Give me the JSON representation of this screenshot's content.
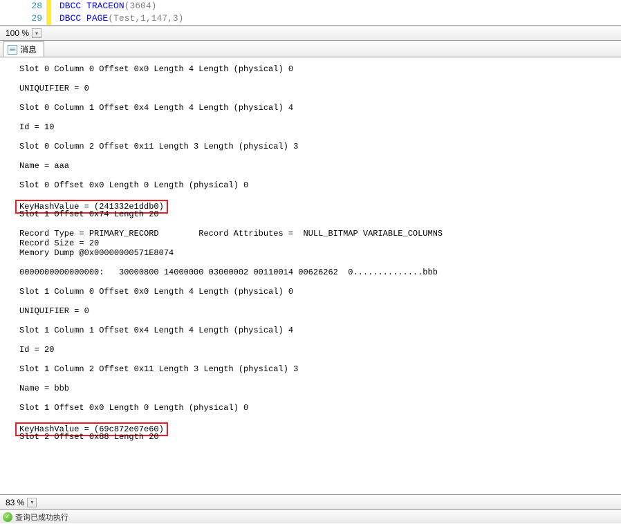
{
  "code": {
    "lines": [
      {
        "num": "28",
        "kw1": "DBCC",
        "rest": "TRACEON",
        "args": "(3604)"
      },
      {
        "num": "29",
        "kw1": "DBCC",
        "rest": "PAGE",
        "args": "(Test,1,147,3)"
      }
    ]
  },
  "zoom_top": "100 %",
  "tab": {
    "label": "消息"
  },
  "output": {
    "lines": [
      "Slot 0 Column 0 Offset 0x0 Length 4 Length (physical) 0",
      "",
      "UNIQUIFIER = 0",
      "",
      "Slot 0 Column 1 Offset 0x4 Length 4 Length (physical) 4",
      "",
      "Id = 10",
      "",
      "Slot 0 Column 2 Offset 0x11 Length 3 Length (physical) 3",
      "",
      "Name = aaa",
      "",
      "Slot 0 Offset 0x0 Length 0 Length (physical) 0",
      "",
      "KeyHashValue = (241332e1ddb0)",
      "Slot 1 Offset 0x74 Length 20",
      "",
      "Record Type = PRIMARY_RECORD        Record Attributes =  NULL_BITMAP VARIABLE_COLUMNS",
      "Record Size = 20",
      "Memory Dump @0x00000000571E8074",
      "",
      "0000000000000000:   30000800 14000000 03000002 00110014 00626262  0..............bbb",
      "",
      "Slot 1 Column 0 Offset 0x0 Length 4 Length (physical) 0",
      "",
      "UNIQUIFIER = 0",
      "",
      "Slot 1 Column 1 Offset 0x4 Length 4 Length (physical) 4",
      "",
      "Id = 20",
      "",
      "Slot 1 Column 2 Offset 0x11 Length 3 Length (physical) 3",
      "",
      "Name = bbb",
      "",
      "Slot 1 Offset 0x0 Length 0 Length (physical) 0",
      "",
      "KeyHashValue = (69c872e07e60)",
      "Slot 2 Offset 0x88 Length 20",
      ""
    ],
    "highlighted_indices": [
      14,
      37
    ]
  },
  "zoom_bottom": "83 %",
  "status": "查询已成功执行"
}
